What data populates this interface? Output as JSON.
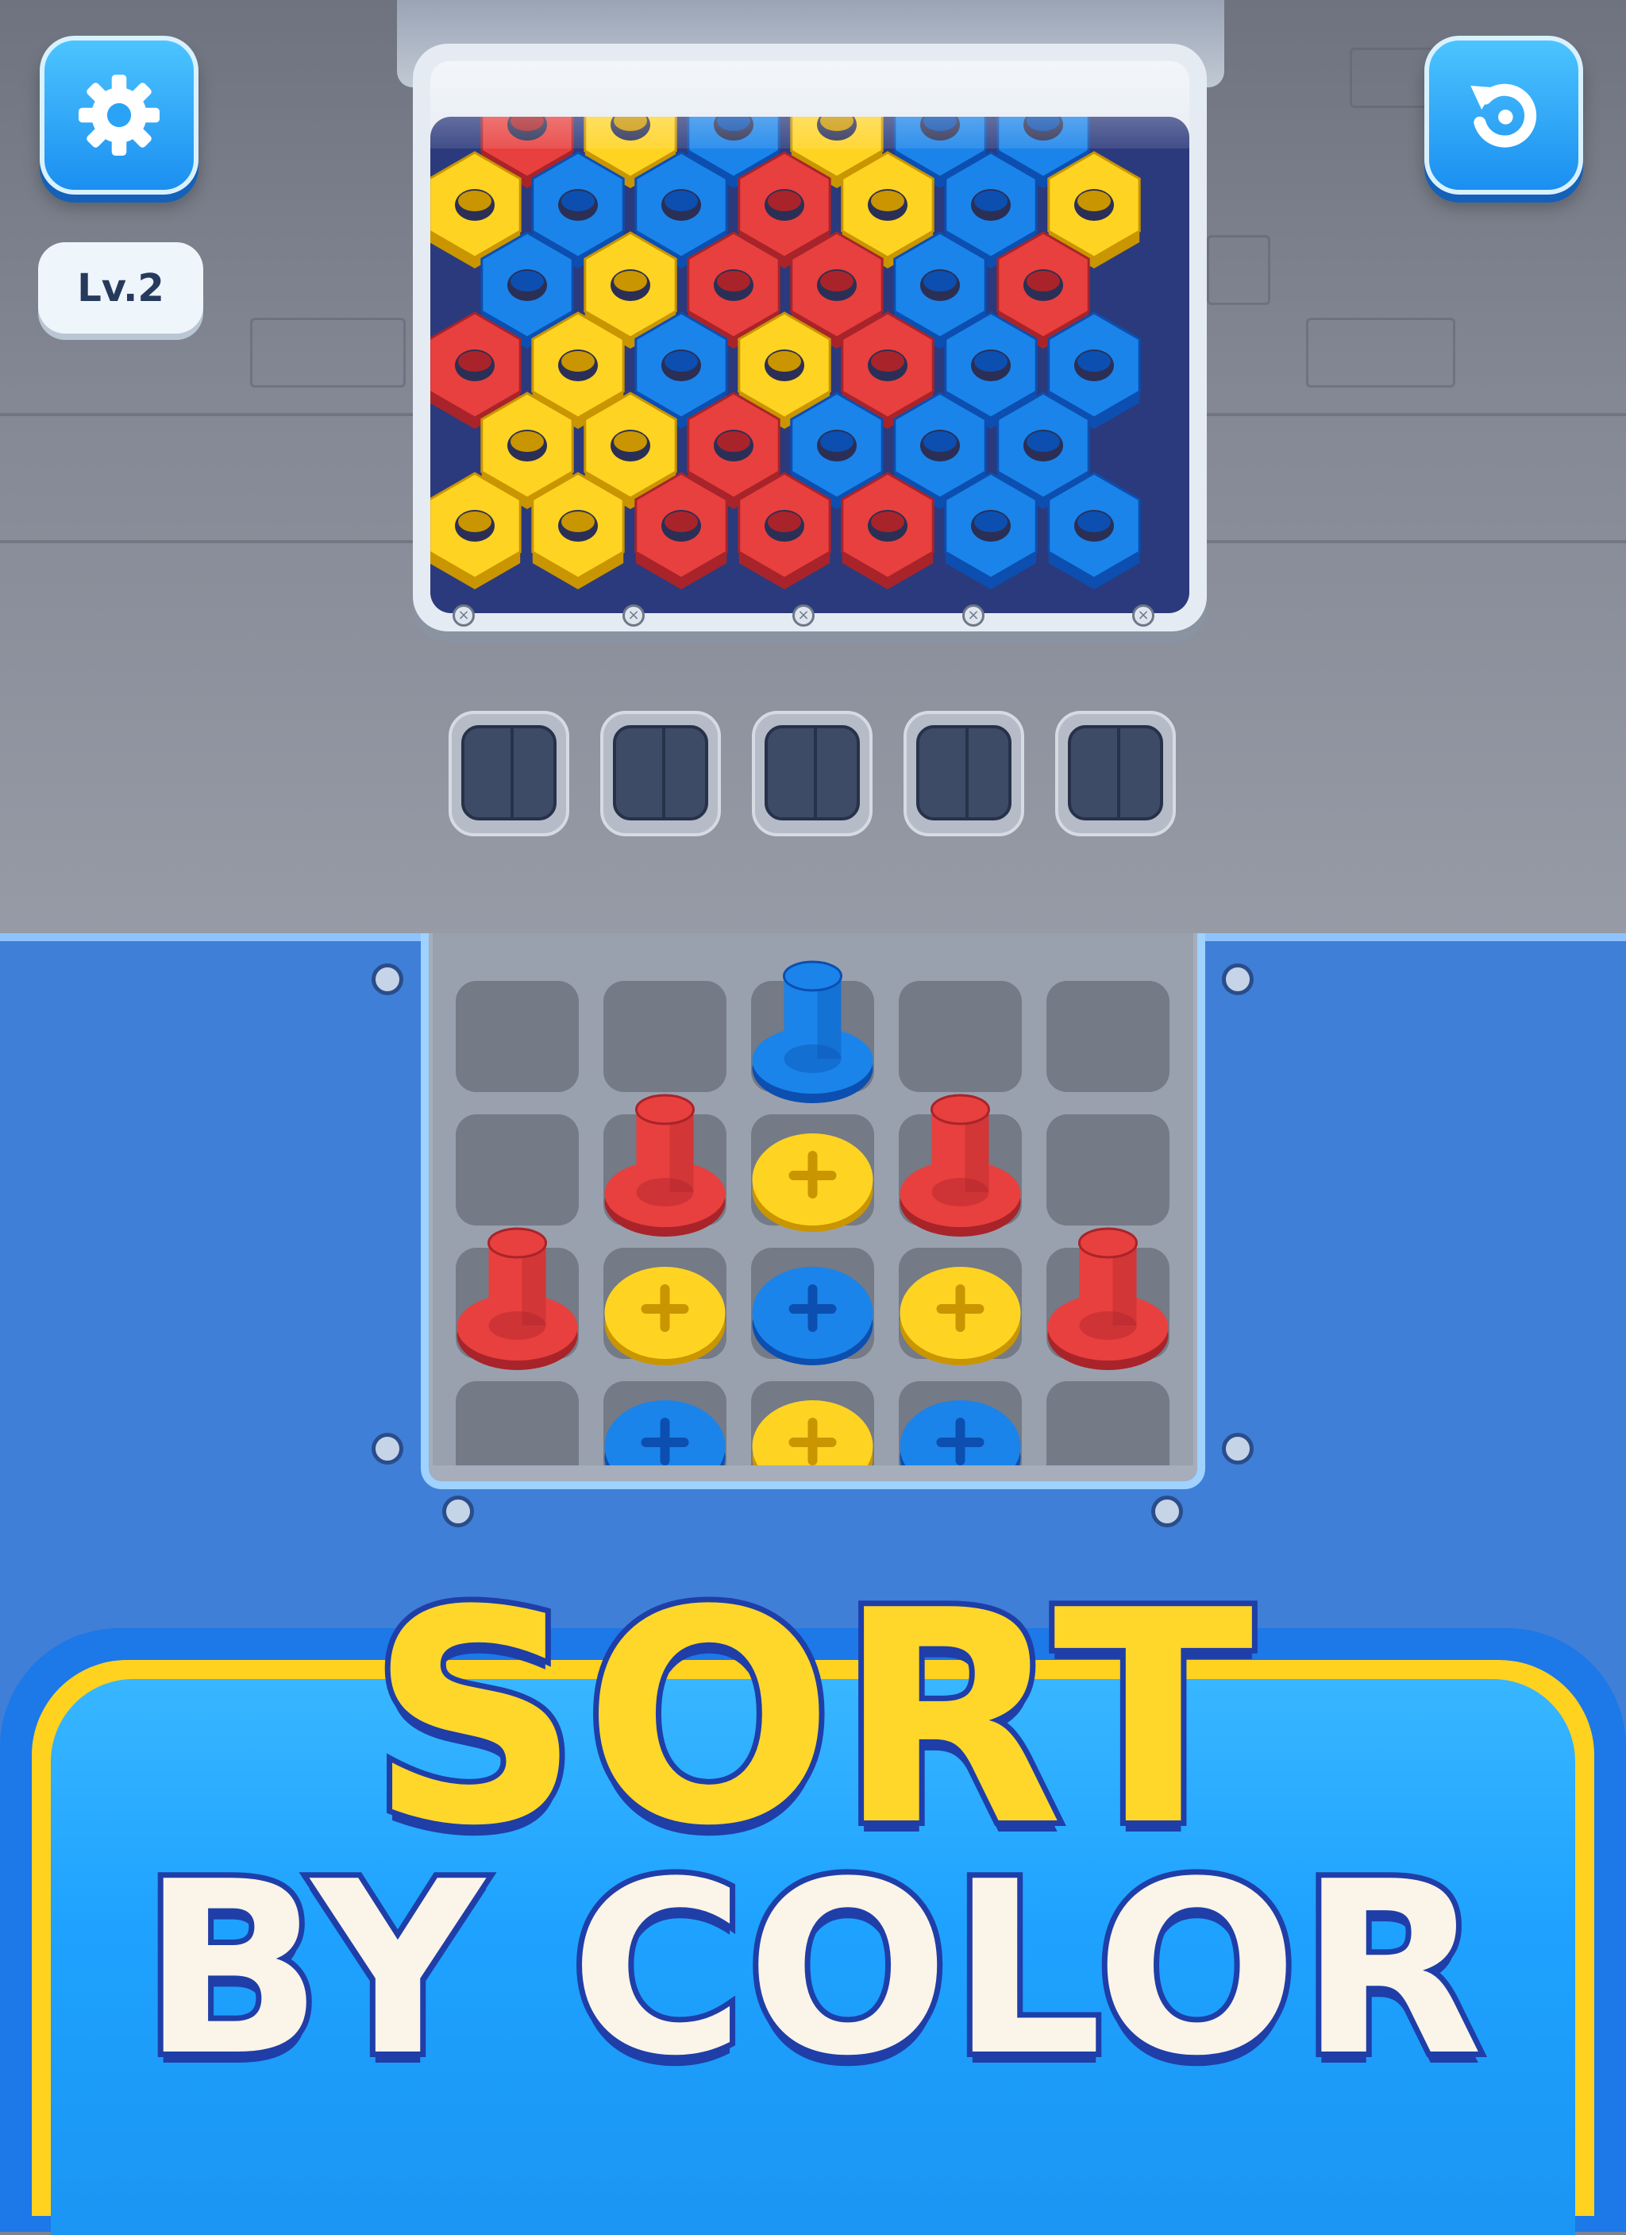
{
  "top_bar": {
    "settings_icon": "gear-icon",
    "restart_icon": "restart-icon",
    "level_label": "Lv.2"
  },
  "hex_board": {
    "visible_rows": [
      [
        "red",
        "yellow",
        "blue",
        "yellow",
        "blue",
        "blue"
      ],
      [
        "yellow",
        "blue",
        "blue",
        "red",
        "yellow",
        "blue",
        "yellow"
      ],
      [
        "blue",
        "yellow",
        "red",
        "red",
        "blue",
        "red"
      ],
      [
        "red",
        "yellow",
        "blue",
        "yellow",
        "red",
        "blue",
        "blue"
      ],
      [
        "yellow",
        "yellow",
        "red",
        "blue",
        "blue",
        "blue"
      ],
      [
        "yellow",
        "yellow",
        "red",
        "red",
        "red",
        "blue",
        "blue"
      ]
    ]
  },
  "slots": [
    {
      "state": "empty"
    },
    {
      "state": "empty"
    },
    {
      "state": "empty"
    },
    {
      "state": "empty"
    },
    {
      "state": "empty"
    }
  ],
  "screw_grid": [
    [
      "empty",
      "empty",
      "blue_raised",
      "empty",
      "empty"
    ],
    [
      "empty",
      "red_raised",
      "yellow_head",
      "red_raised",
      "empty"
    ],
    [
      "red_raised",
      "yellow_head",
      "blue_head",
      "yellow_head",
      "red_raised"
    ],
    [
      "empty",
      "blue_head",
      "yellow_head",
      "blue_head",
      "empty"
    ]
  ],
  "banner": {
    "line1": "SORT",
    "line2": "BY COLOR"
  },
  "colors": {
    "red": "#e8403e",
    "yellow": "#ffd322",
    "blue": "#1a84ea",
    "accent": "#1b95f3"
  }
}
